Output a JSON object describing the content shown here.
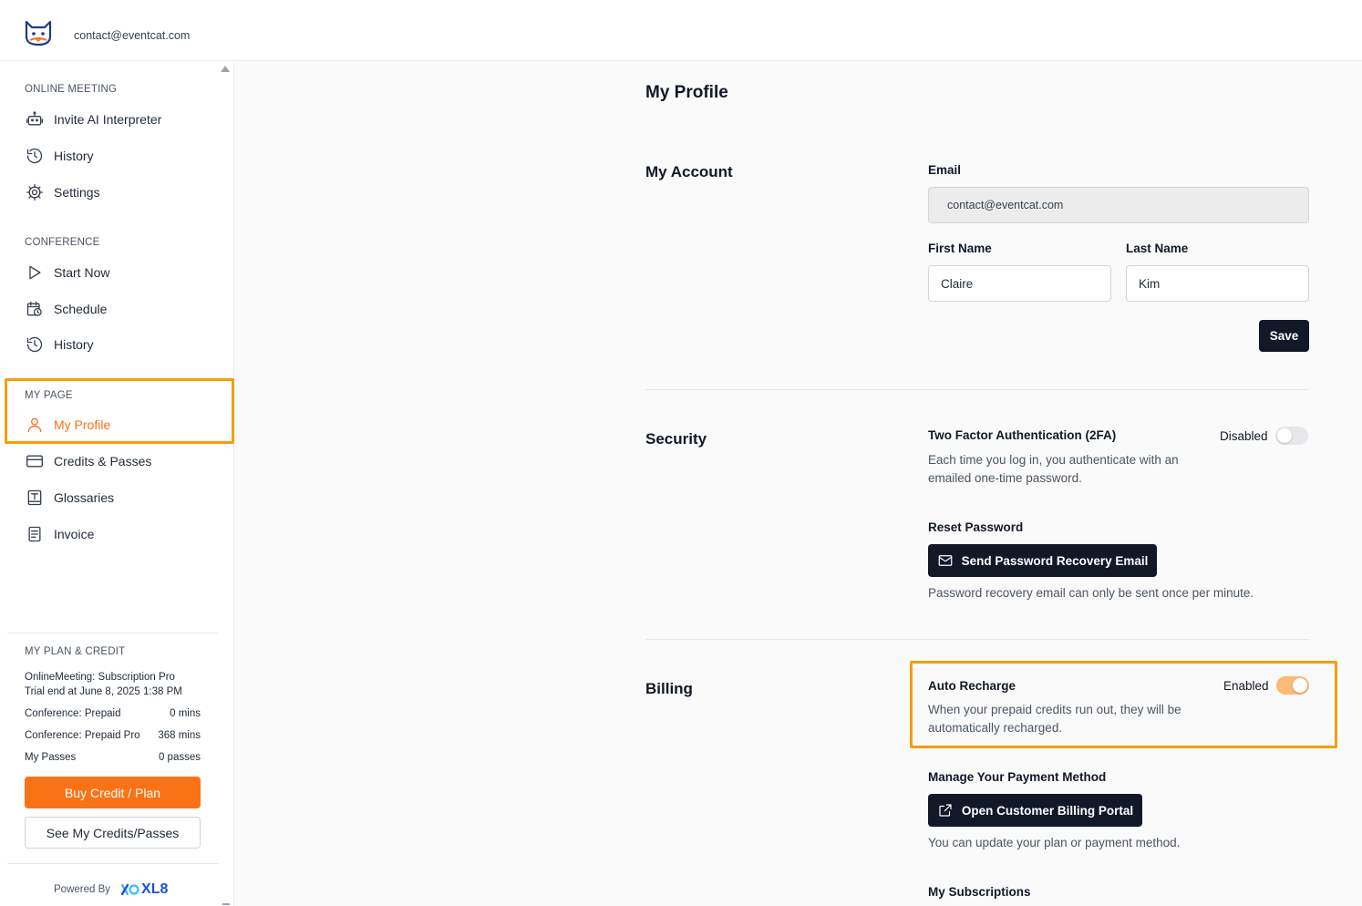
{
  "header": {
    "email": "contact@eventcat.com"
  },
  "sidebar": {
    "online_meeting": {
      "title": "ONLINE MEETING",
      "items": [
        {
          "label": "Invite AI Interpreter",
          "icon": "robot-icon"
        },
        {
          "label": "History",
          "icon": "history-icon"
        },
        {
          "label": "Settings",
          "icon": "gear-icon"
        }
      ]
    },
    "conference": {
      "title": "CONFERENCE",
      "items": [
        {
          "label": "Start Now",
          "icon": "play-icon"
        },
        {
          "label": "Schedule",
          "icon": "calendar-clock-icon"
        },
        {
          "label": "History",
          "icon": "history-icon"
        }
      ]
    },
    "my_page": {
      "title": "MY PAGE",
      "items": [
        {
          "label": "My Profile",
          "icon": "user-icon",
          "active": true
        },
        {
          "label": "Credits & Passes",
          "icon": "card-icon"
        },
        {
          "label": "Glossaries",
          "icon": "glossary-icon"
        },
        {
          "label": "Invoice",
          "icon": "invoice-icon"
        }
      ]
    },
    "plan": {
      "title": "MY PLAN & CREDIT",
      "subscription": "OnlineMeeting: Subscription Pro",
      "trial": "Trial end at June 8, 2025 1:38 PM",
      "rows": [
        {
          "label": "Conference: Prepaid",
          "value": "0 mins"
        },
        {
          "label": "Conference: Prepaid Pro",
          "value": "368 mins"
        },
        {
          "label": "My Passes",
          "value": "0 passes"
        }
      ],
      "buy_label": "Buy Credit / Plan",
      "see_label": "See My Credits/Passes"
    },
    "powered_by": "Powered By",
    "brand": "XL8"
  },
  "main": {
    "page_title": "My Profile",
    "account": {
      "title": "My Account",
      "email_label": "Email",
      "email_value": "contact@eventcat.com",
      "first_name_label": "First Name",
      "first_name_value": "Claire",
      "last_name_label": "Last Name",
      "last_name_value": "Kim",
      "save_label": "Save"
    },
    "security": {
      "title": "Security",
      "twofa_label": "Two Factor Authentication (2FA)",
      "twofa_status": "Disabled",
      "twofa_desc_1": "Each time you log in, you authenticate with an",
      "twofa_desc_2": "emailed one-time password.",
      "reset_label": "Reset Password",
      "reset_button": "Send Password Recovery Email",
      "reset_note": "Password recovery email can only be sent once per minute."
    },
    "billing": {
      "title": "Billing",
      "auto_label": "Auto Recharge",
      "auto_status": "Enabled",
      "auto_desc_1": "When your prepaid credits run out, they will be",
      "auto_desc_2": "automatically recharged.",
      "payment_label": "Manage Your Payment Method",
      "portal_button": "Open Customer Billing Portal",
      "portal_note": "You can update your plan or payment method.",
      "subscriptions_label": "My Subscriptions"
    }
  },
  "colors": {
    "accent": "#f97316",
    "highlight": "#f59e0b",
    "dark_button": "#111827"
  }
}
